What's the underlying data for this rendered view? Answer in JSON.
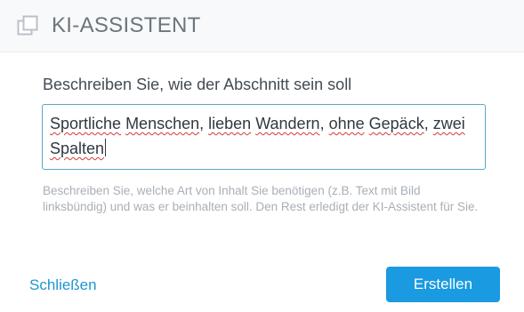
{
  "dialog": {
    "title": "KI-ASSISTENT",
    "icon": "copy-icon",
    "prompt_label": "Beschreiben Sie, wie der Abschnitt sein soll",
    "input": {
      "words": [
        "Sportliche",
        " ",
        "Menschen",
        ", ",
        "lieben",
        " ",
        "Wandern",
        ", ",
        "ohne",
        " ",
        "Gepäck",
        ", ",
        "zwei",
        " ",
        "Spalten"
      ],
      "value": "Sportliche Menschen, lieben Wandern, ohne Gepäck, zwei Spalten"
    },
    "help_text": "Beschreiben Sie, welche Art von Inhalt Sie benötigen (z.B. Text mit Bild linksbündig) und was er beinhalten soll. Den Rest erledigt der KI-Assistent für Sie.",
    "close_label": "Schließen",
    "create_label": "Erstellen"
  },
  "colors": {
    "accent": "#1a9ae0",
    "link": "#1e96d2",
    "input_border": "#5aa7c9",
    "spellcheck": "#d33a3a"
  }
}
